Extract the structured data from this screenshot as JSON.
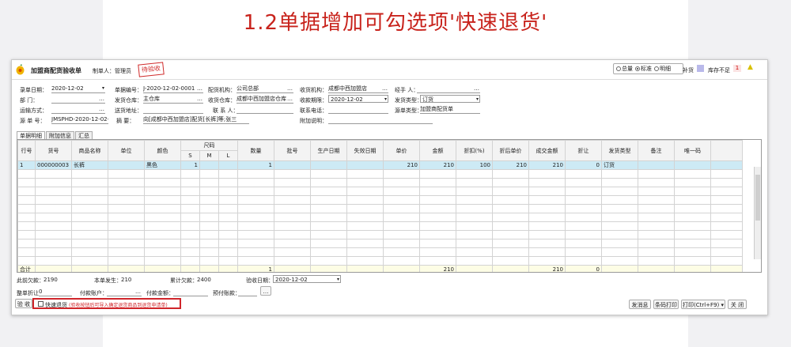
{
  "banner": {
    "title": "1.2单据增加可勾选项'快速退货'"
  },
  "window": {
    "title": "加盟商配货验收单",
    "maker_label": "制单人：",
    "maker_value": "管理员",
    "stamp": "待验收",
    "view_options": [
      "总量",
      "标准",
      "明细"
    ],
    "view_selected": "标准",
    "legend_supplement": "补货",
    "legend_stock_short": "库存不足",
    "legend_stock_short_count": "1",
    "accent_color": "#c8231c"
  },
  "form": {
    "row1": {
      "date_label": "录单日期：",
      "date_value": "2020-12-02",
      "doc_no_label": "单据编号：",
      "doc_no_value": "J-2020-12-02-0001",
      "dist_org_label": "配货机构：",
      "dist_org_value": "公司总部",
      "recv_org_label": "收货机构：",
      "recv_org_value": "成都中西加盟店",
      "handler_label": "经手 人："
    },
    "row2": {
      "dept_label": "部  门：",
      "send_wh_label": "发货仓库：",
      "send_wh_value": "主仓库",
      "recv_wh_label": "收货仓库：",
      "recv_wh_value": "成都中西加盟店仓库",
      "recv_period_label": "收款期限：",
      "recv_period_value": "2020-12-02",
      "ship_type_label": "发货类型：",
      "ship_type_value": "订货"
    },
    "row3": {
      "transport_label": "运输方式：",
      "ship_addr_label": "送货地址：",
      "contact_label": "联 系 人：",
      "phone_label": "联系电话：",
      "source_type_label": "源单类型：",
      "source_type_value": "加盟商配货单"
    },
    "row4": {
      "source_no_label": "源 单 号：",
      "source_no_value": "JMSPHD-2020-12-02-0",
      "summary_label": "摘  要：",
      "summary_value": "向[成都中西加盟店]配货[长裤]等;张三",
      "extra_label": "附加说明："
    }
  },
  "tabs": [
    "单据明细",
    "附加信息",
    "汇总"
  ],
  "table": {
    "headers": [
      "行号",
      "货号",
      "商品名称",
      "单位",
      "颜色",
      "尺码",
      "数量",
      "批号",
      "生产日期",
      "失效日期",
      "单价",
      "金额",
      "折扣(%)",
      "折后单价",
      "成交金额",
      "折让",
      "发货类型",
      "备注",
      "唯一码"
    ],
    "size_cols": [
      "S",
      "M",
      "L"
    ],
    "rows": [
      {
        "no": "1",
        "code": "000000003",
        "name": "长裤",
        "unit": "",
        "color": "黑色",
        "s": "1",
        "m": "",
        "l": "",
        "qty": "1",
        "batch": "",
        "prod": "",
        "exp": "",
        "price": "210",
        "amount": "210",
        "disc": "100",
        "dprice": "210",
        "deal": "210",
        "allow": "0",
        "stype": "订货",
        "note": "",
        "uid": ""
      }
    ],
    "sum": {
      "label": "合计",
      "qty": "1",
      "amount": "210",
      "deal": "210",
      "allow": "0"
    }
  },
  "footer": {
    "prev_owe_label": "此前欠款：",
    "prev_owe_value": "2190",
    "this_owe_label": "本单发生：",
    "this_owe_value": "210",
    "total_owe_label": "累计欠款：",
    "total_owe_value": "2400",
    "accept_date_label": "验收日期：",
    "accept_date_value": "2020-12-02",
    "whole_disc_label": "整单折让",
    "whole_disc_value": "0",
    "pay_acct_label": "付款账户：",
    "pay_amount_label": "付款金额：",
    "prepay_label": "预付账款：",
    "accept_button": "验 收",
    "quick_return_label": "快速退货",
    "quick_return_note": "(验收按钮后可导入确定退货商品到退货申请单)",
    "msg_button": "发消息",
    "print_setting_button": "条码打印",
    "print_button": "打印(Ctrl+F9)",
    "close_button": "关 闭"
  }
}
